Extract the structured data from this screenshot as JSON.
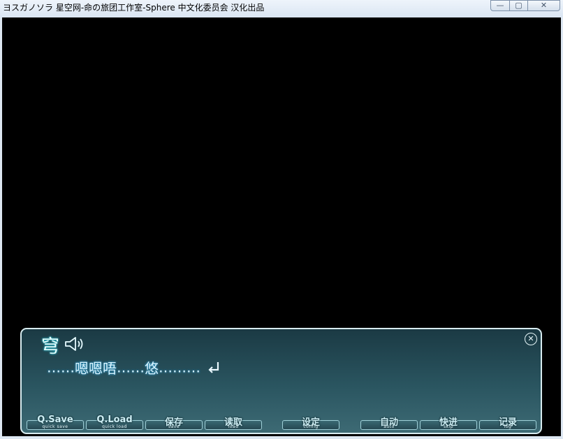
{
  "window": {
    "title": "ヨスガノソラ 星空网-命の旅团工作室-Sphere 中文化委员会 汉化出品",
    "buttons": {
      "minimize": "—",
      "maximize": "▢",
      "close": "✕"
    }
  },
  "message": {
    "speaker": "穹",
    "text_prefix": "……",
    "text_main": "嗯嗯唔",
    "text_mid": "……",
    "text_name": "悠",
    "text_suffix": "………",
    "close_glyph": "✕",
    "icons": {
      "voice": "speaker-icon",
      "continue": "enter-arrow-icon",
      "close": "close-icon"
    }
  },
  "menu": [
    {
      "label": "Q.Save",
      "sub": "quick save"
    },
    {
      "label": "Q.Load",
      "sub": "quick load"
    },
    {
      "label": "保存",
      "sub": "save"
    },
    {
      "label": "读取",
      "sub": "load"
    },
    {
      "label": "设定",
      "sub": "config"
    },
    {
      "label": "自动",
      "sub": "auto"
    },
    {
      "label": "快进",
      "sub": "skip"
    },
    {
      "label": "记录",
      "sub": "log"
    }
  ]
}
